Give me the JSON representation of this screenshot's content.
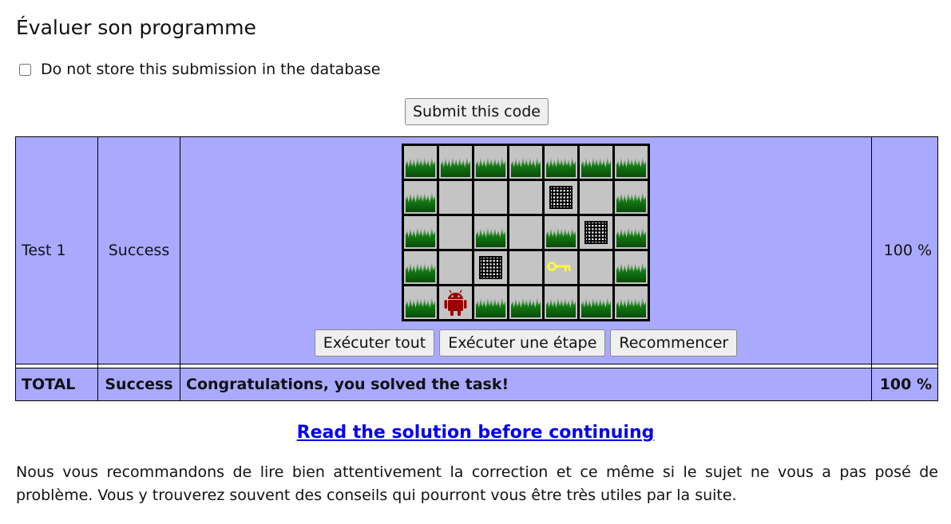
{
  "page": {
    "title": "Évaluer son programme",
    "store_label": "Do not store this submission in the database",
    "submit_label": "Submit this code"
  },
  "results": {
    "test_row": {
      "name": "Test 1",
      "status": "Success",
      "score": "100 %"
    },
    "total_row": {
      "name": "TOTAL",
      "status": "Success",
      "message": "Congratulations, you solved the task!",
      "score": "100 %"
    }
  },
  "board": {
    "rows": [
      [
        "grass",
        "grass",
        "grass",
        "grass",
        "grass",
        "grass",
        "grass"
      ],
      [
        "grass",
        "empty",
        "empty",
        "empty",
        "wall",
        "empty",
        "grass"
      ],
      [
        "grass",
        "empty",
        "grass",
        "empty",
        "grass",
        "wall",
        "grass"
      ],
      [
        "grass",
        "empty",
        "wall",
        "empty",
        "key",
        "empty",
        "grass"
      ],
      [
        "grass",
        "robot",
        "grass",
        "grass",
        "grass",
        "grass",
        "grass"
      ]
    ],
    "colors": {
      "grass": "#137a13",
      "floor": "#c4c4c4",
      "key": "#ffff33",
      "robot": "#990000"
    }
  },
  "controls": {
    "run_all": "Exécuter tout",
    "run_step": "Exécuter une étape",
    "restart": "Recommencer"
  },
  "footer": {
    "solution_link": "Read the solution before continuing",
    "advice": "Nous vous recommandons de lire bien attentivement la correction et ce même si le sujet ne vous a pas posé de problème. Vous y trouverez souvent des conseils qui pourront vous être très utiles par la suite."
  }
}
